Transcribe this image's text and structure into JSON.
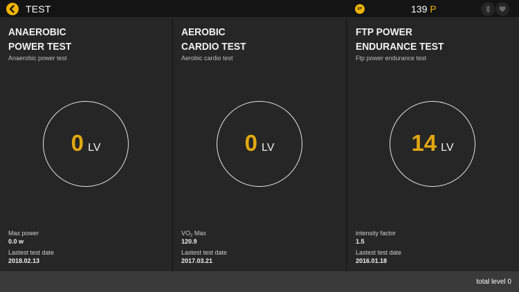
{
  "header": {
    "title": "TEST",
    "ep_badge": "EP",
    "points_value": "139",
    "points_unit": "P"
  },
  "icons": {
    "back": "chevron-left-icon",
    "bluetooth": "bluetooth-icon",
    "heart": "heart-icon"
  },
  "colors": {
    "accent": "#f0b400",
    "level_number": "#e2a812",
    "panel_bg": "#262626",
    "topbar_bg": "#141414",
    "bottombar_bg": "#3a3a3a"
  },
  "tests": [
    {
      "title_line1": "ANAEROBIC",
      "title_line2": "POWER TEST",
      "subtitle": "Anaerobic power test",
      "level": "0",
      "level_unit": "LV",
      "metric_label": "Max power",
      "metric_value": "0.0 w",
      "date_label": "Lastest test date",
      "date_value": "2018.02.13"
    },
    {
      "title_line1": "AEROBIC",
      "title_line2": "CARDIO TEST",
      "subtitle": "Aerobic cardio test",
      "level": "0",
      "level_unit": "LV",
      "metric_label_main": "VO",
      "metric_label_sub": "2",
      "metric_label_tail": " Max",
      "metric_value": "120.9",
      "date_label": "Lastest test date",
      "date_value": "2017.03.21"
    },
    {
      "title_line1": "FTP POWER",
      "title_line2": "ENDURANCE TEST",
      "subtitle": "Ftp power endurance test",
      "level": "14",
      "level_unit": "LV",
      "metric_label": "intensity factor",
      "metric_value": "1.5",
      "date_label": "Lastest test date",
      "date_value": "2016.01.18"
    }
  ],
  "footer": {
    "total_level": "total level 0"
  }
}
